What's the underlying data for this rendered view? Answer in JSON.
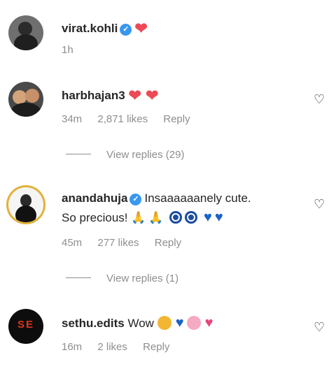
{
  "comments": [
    {
      "username": "virat.kohli",
      "verified": true,
      "text": "❤",
      "time": "1h",
      "likes": "",
      "reply": ""
    },
    {
      "username": "harbhajan3",
      "verified": false,
      "text": "❤ ❤",
      "time": "34m",
      "likes": "2,871 likes",
      "reply": "Reply",
      "view_replies": "View replies (29)"
    },
    {
      "username": "anandahuja",
      "verified": true,
      "text_line1": "Insaaaaaanely cute.",
      "text_line2": "So precious!",
      "time": "45m",
      "likes": "277 likes",
      "reply": "Reply",
      "view_replies": "View replies (1)"
    },
    {
      "username": "sethu.edits",
      "verified": false,
      "text": "Wow",
      "time": "16m",
      "likes": "2 likes",
      "reply": "Reply",
      "avatar_text": "SE"
    }
  ],
  "icons": {
    "verified": "✓",
    "like": "♡",
    "red_heart": "❤",
    "blue_heart": "♥",
    "pray": "🙏"
  },
  "colors": {
    "verified": "#3897f0",
    "meta_gray": "#8e8e8e",
    "red_heart": "#ed4956",
    "blue_heart": "#1a63c6"
  }
}
